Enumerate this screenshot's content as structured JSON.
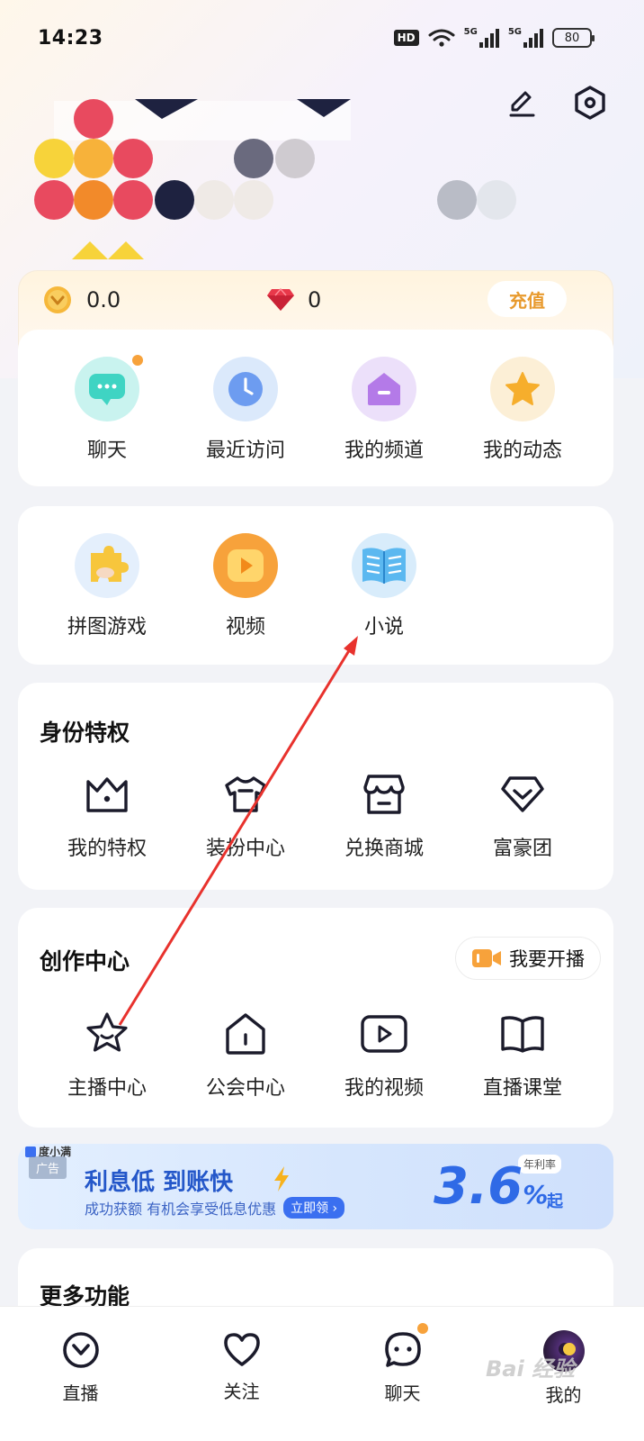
{
  "status_bar": {
    "time": "14:23",
    "battery": "80",
    "hd": "HD",
    "net1": "5G",
    "net2": "5G"
  },
  "wallet": {
    "coins": "0.0",
    "gems": "0",
    "recharge_label": "充值"
  },
  "quick_actions": [
    {
      "label": "聊天",
      "icon": "chat-bubble-icon"
    },
    {
      "label": "最近访问",
      "icon": "clock-icon"
    },
    {
      "label": "我的频道",
      "icon": "channel-home-icon"
    },
    {
      "label": "我的动态",
      "icon": "star-icon"
    }
  ],
  "apps": [
    {
      "label": "拼图游戏",
      "icon": "puzzle-icon"
    },
    {
      "label": "视频",
      "icon": "video-play-icon"
    },
    {
      "label": "小说",
      "icon": "book-icon"
    }
  ],
  "identity": {
    "title": "身份特权",
    "items": [
      {
        "label": "我的特权",
        "icon": "crown-icon"
      },
      {
        "label": "装扮中心",
        "icon": "tshirt-icon"
      },
      {
        "label": "兑换商城",
        "icon": "store-icon"
      },
      {
        "label": "富豪团",
        "icon": "diamond-icon"
      }
    ]
  },
  "creator": {
    "title": "创作中心",
    "live_label": "我要开播",
    "items": [
      {
        "label": "主播中心",
        "icon": "anchor-star-icon"
      },
      {
        "label": "公会中心",
        "icon": "guild-house-icon"
      },
      {
        "label": "我的视频",
        "icon": "my-video-icon"
      },
      {
        "label": "直播课堂",
        "icon": "open-book-icon"
      }
    ]
  },
  "ad": {
    "tag": "广告",
    "brand": "度小满",
    "headline": "利息低 到账快",
    "subline": "成功获额 有机会享受低息优惠",
    "cta": "立即领",
    "rate": "3.6",
    "rate_unit": "%",
    "rate_suffix": "起",
    "rate_label": "年利率"
  },
  "more": {
    "title": "更多功能"
  },
  "tabbar": [
    {
      "label": "直播",
      "icon": "live-tab-icon"
    },
    {
      "label": "关注",
      "icon": "heart-icon"
    },
    {
      "label": "聊天",
      "icon": "chat-tab-icon"
    },
    {
      "label": "我的",
      "icon": "avatar"
    }
  ],
  "watermark": "Bai 经验",
  "colors": {
    "accent_orange": "#f7a23b",
    "recharge": "#e89a2d",
    "ad_blue": "#2f6ae6",
    "arrow": "#e8322d"
  }
}
